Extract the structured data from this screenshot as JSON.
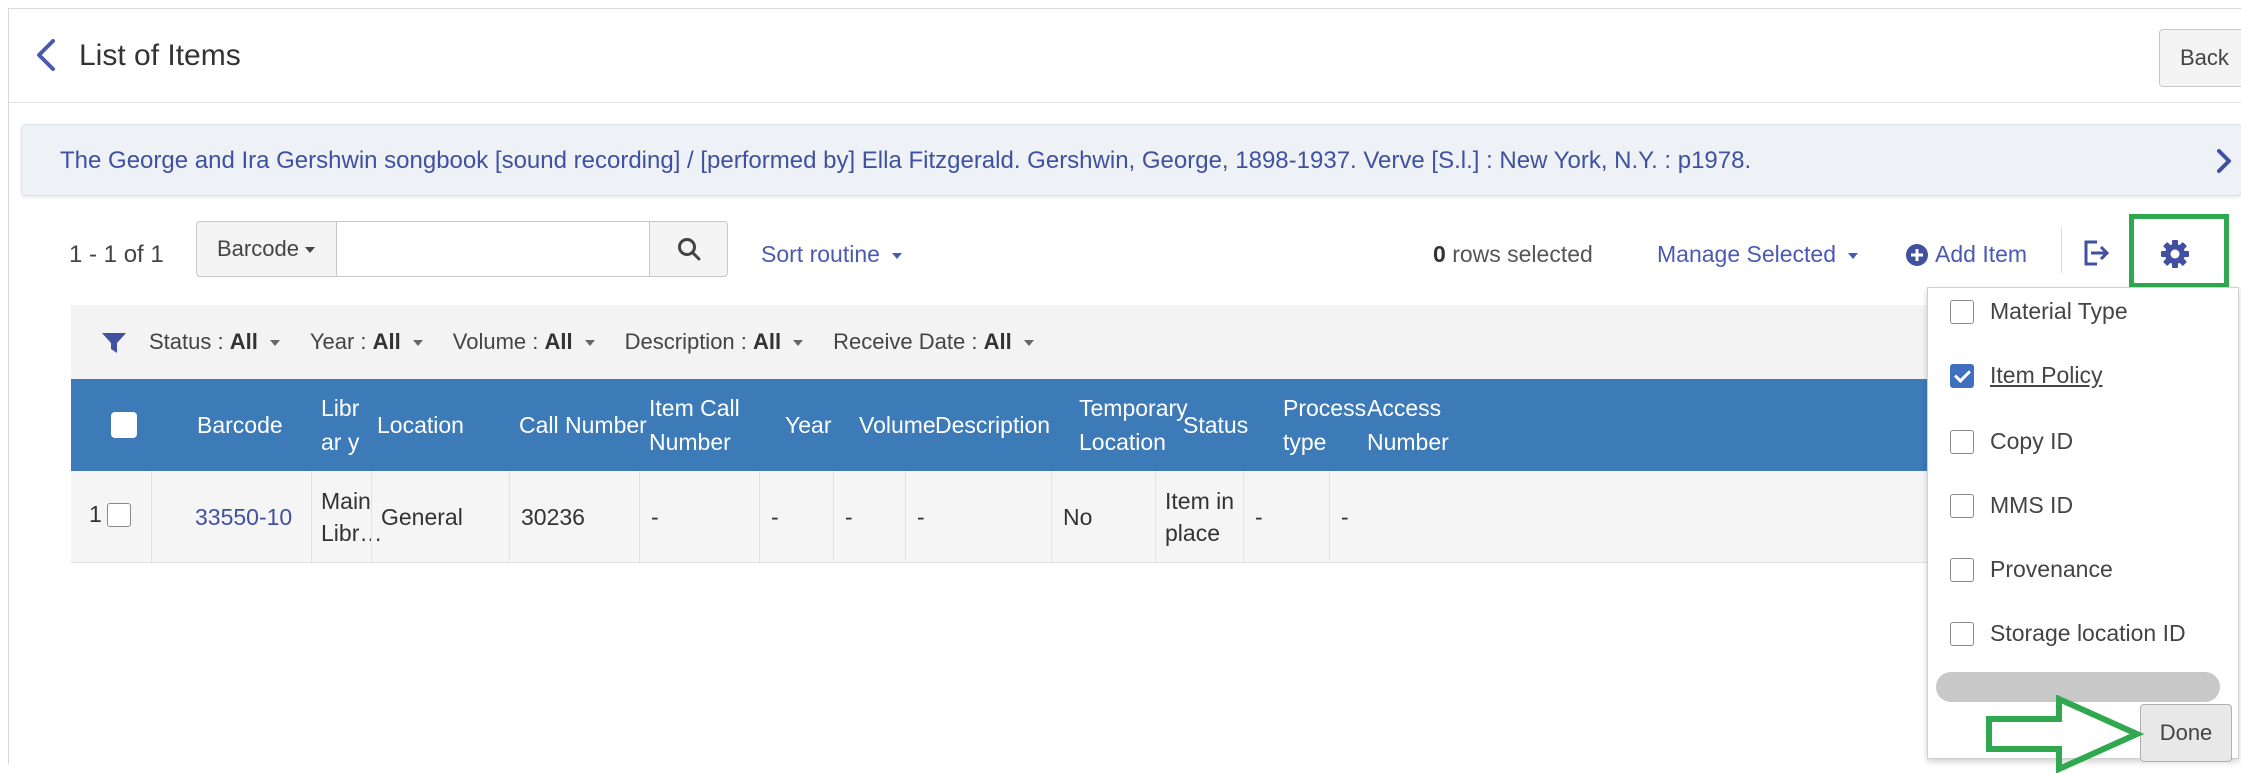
{
  "header": {
    "title": "List of Items",
    "back_label": "Back"
  },
  "record": {
    "title": "The George and Ira Gershwin songbook [sound recording] / [performed by] Ella Fitzgerald. Gershwin, George, 1898-1937. Verve [S.l.] : New York, N.Y. : p1978."
  },
  "toolbar": {
    "count": "1 - 1 of 1",
    "search_type": "Barcode",
    "search_value": "",
    "sort_label": "Sort routine",
    "rows_selected_count": "0",
    "rows_selected_label": "rows selected",
    "manage_selected": "Manage Selected",
    "add_item": "Add Item"
  },
  "filters": [
    {
      "label": "Status",
      "value": "All"
    },
    {
      "label": "Year",
      "value": "All"
    },
    {
      "label": "Volume",
      "value": "All"
    },
    {
      "label": "Description",
      "value": "All"
    },
    {
      "label": "Receive Date",
      "value": "All"
    }
  ],
  "table": {
    "columns": [
      "Barcode",
      "Librar y",
      "Location",
      "Call Number",
      "Item Call Number",
      "Year",
      "Volume",
      "Description",
      "Temporary Location",
      "Status",
      "Process type",
      "Access Number"
    ],
    "rows": [
      {
        "index": "1",
        "barcode": "33550-10",
        "library": "Main Libr…",
        "location": "General",
        "call_number": "30236",
        "item_call_number": "-",
        "year": "-",
        "volume": "-",
        "description": "-",
        "temporary_location": "No",
        "status": "Item in place",
        "process_type": "-",
        "access_number": "-"
      }
    ]
  },
  "column_chooser": {
    "options": [
      {
        "label": "Material Type",
        "checked": false
      },
      {
        "label": "Item Policy",
        "checked": true
      },
      {
        "label": "Copy ID",
        "checked": false
      },
      {
        "label": "MMS ID",
        "checked": false
      },
      {
        "label": "Provenance",
        "checked": false
      },
      {
        "label": "Storage location ID",
        "checked": false
      }
    ],
    "done_label": "Done"
  },
  "colors": {
    "accent": "#3d7ab8",
    "link": "#3f51a0",
    "highlight": "#2fa84f"
  }
}
